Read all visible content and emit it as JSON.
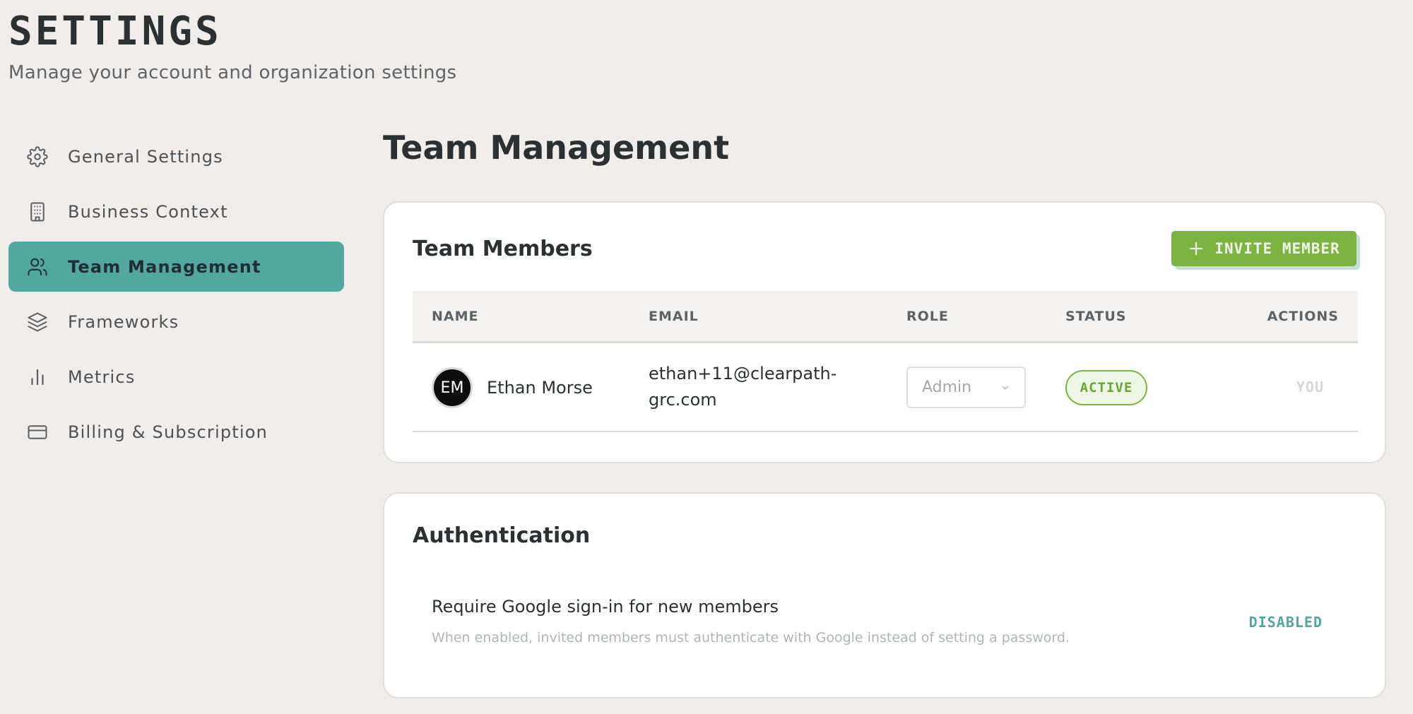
{
  "header": {
    "title": "SETTINGS",
    "subtitle": "Manage your account and organization settings"
  },
  "sidebar": {
    "items": [
      {
        "label": "General Settings",
        "icon": "gear-icon",
        "active": false
      },
      {
        "label": "Business Context",
        "icon": "building-icon",
        "active": false
      },
      {
        "label": "Team Management",
        "icon": "users-icon",
        "active": true
      },
      {
        "label": "Frameworks",
        "icon": "layers-icon",
        "active": false
      },
      {
        "label": "Metrics",
        "icon": "bar-chart-icon",
        "active": false
      },
      {
        "label": "Billing & Subscription",
        "icon": "credit-card-icon",
        "active": false
      }
    ]
  },
  "main": {
    "title": "Team Management",
    "members_card": {
      "title": "Team Members",
      "invite_label": "INVITE MEMBER",
      "columns": [
        "NAME",
        "EMAIL",
        "ROLE",
        "STATUS",
        "ACTIONS"
      ],
      "rows": [
        {
          "initials": "EM",
          "name": "Ethan Morse",
          "email": "ethan+11@clearpath-grc.com",
          "role": "Admin",
          "status": "ACTIVE",
          "action": "YOU"
        }
      ]
    },
    "auth_card": {
      "title": "Authentication",
      "setting_title": "Require Google sign-in for new members",
      "setting_desc": "When enabled, invited members must authenticate with Google instead of setting a password.",
      "setting_status": "DISABLED"
    }
  },
  "colors": {
    "background": "#f0edea",
    "accent_teal": "#52a79e",
    "accent_green": "#7cb342",
    "text_dark": "#2b3033"
  }
}
